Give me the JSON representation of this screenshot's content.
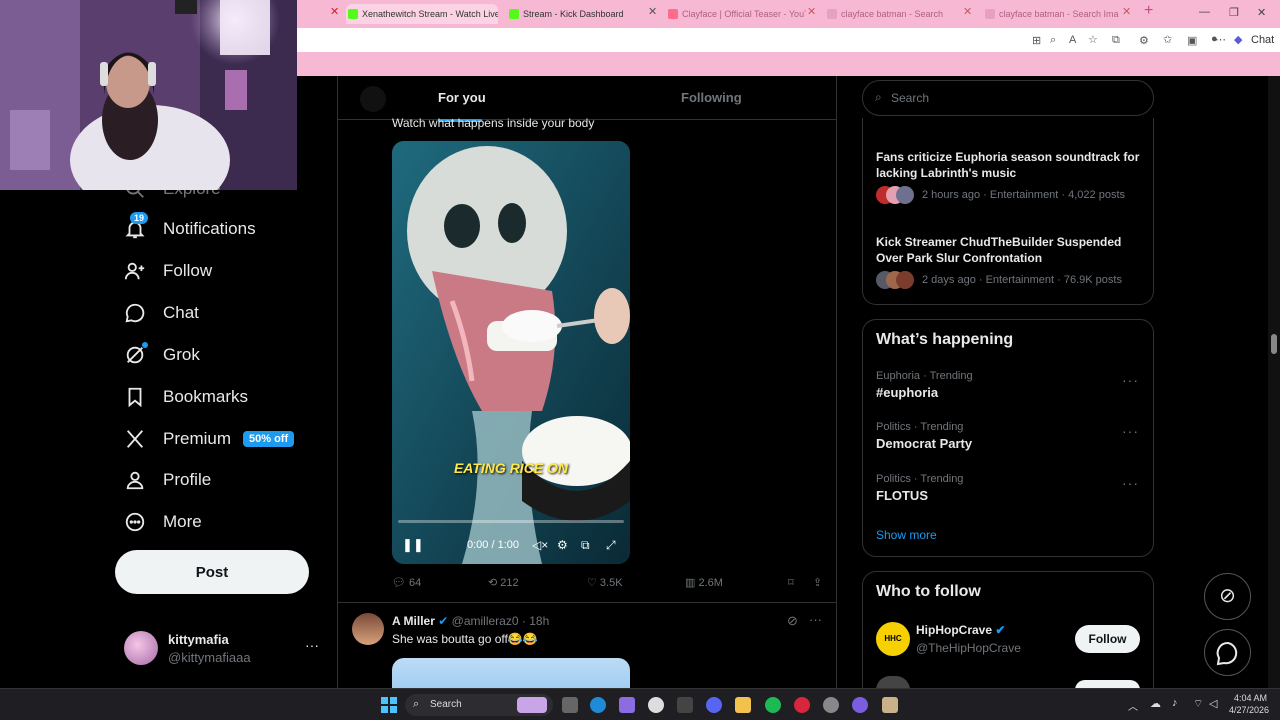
{
  "browser": {
    "tabs": [
      {
        "title": "Xenathewitch Stream - Watch Live",
        "color": "#53fc18"
      },
      {
        "title": "Stream - Kick Dashboard",
        "color": "#53fc18"
      },
      {
        "title": "Clayface | Official Teaser - YouTube",
        "color": "#ff0000"
      },
      {
        "title": "clayface batman - Search",
        "color": "#888888"
      },
      {
        "title": "clayface batman - Search Images",
        "color": "#888888"
      }
    ],
    "new_tab": "+",
    "chat_label": "Chat"
  },
  "nav": {
    "explore": "Explore",
    "notifications": "Notifications",
    "notifications_badge": "19",
    "follow": "Follow",
    "chat": "Chat",
    "grok": "Grok",
    "bookmarks": "Bookmarks",
    "premium": "Premium",
    "premium_badge": "50% off",
    "profile": "Profile",
    "more": "More",
    "post": "Post",
    "account_name": "kittymafia",
    "account_handle": "@kittymafiaaa"
  },
  "feed": {
    "tab_for_you": "For you",
    "tab_following": "Following",
    "post1": {
      "text": "Watch what happens inside your body",
      "caption": "EATING RICE ON",
      "time": "0:00 / 1:00",
      "progress": 0.0,
      "replies": "64",
      "reposts": "212",
      "likes": "3.5K",
      "views": "2.6M"
    },
    "post2": {
      "name": "A Miller",
      "handle": "@amilleraz0",
      "time": "18h",
      "text": "She was boutta go off😂😂"
    }
  },
  "right": {
    "search_placeholder": "Search",
    "news": [
      {
        "title": "Fans criticize Euphoria season soundtrack for lacking Labrinth's music",
        "meta": "2 hours ago · Entertainment · 4,022 posts"
      },
      {
        "title": "Kick Streamer ChudTheBuilder Suspended Over Park Slur Confrontation",
        "meta": "2 days ago · Entertainment · 76.9K posts"
      }
    ],
    "happening_title": "What’s happening",
    "trends": [
      {
        "meta": "Euphoria · Trending",
        "name": "#euphoria"
      },
      {
        "meta": "Politics · Trending",
        "name": "Democrat Party"
      },
      {
        "meta": "Politics · Trending",
        "name": "FLOTUS"
      }
    ],
    "show_more": "Show more",
    "who_title": "Who to follow",
    "follow_suggestion": {
      "name": "HipHopCrave",
      "handle": "@TheHipHopCrave",
      "button": "Follow"
    }
  },
  "taskbar": {
    "search": "Search",
    "time": "4:04 AM",
    "date": "4/27/2026"
  },
  "colors": {
    "accent": "#1d9bf0",
    "bg": "#000000",
    "tabbar": "#f6b8d3"
  }
}
